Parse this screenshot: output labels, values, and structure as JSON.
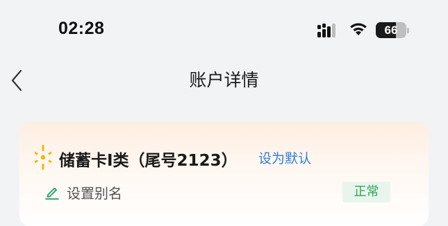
{
  "status_bar": {
    "time": "02:28",
    "battery_text": "66",
    "battery_level_percent": 66,
    "icons": [
      "signal-icon",
      "wifi-icon",
      "battery-icon"
    ]
  },
  "nav": {
    "back_icon": "chevron-left-icon",
    "title": "账户详情"
  },
  "card": {
    "logo_icon": "bank-logo-icon",
    "name": "储蓄卡I类（尾号2123）",
    "set_default_label": "设为默认",
    "alias_icon": "pencil-icon",
    "alias_label": "设置别名",
    "status_label": "正常"
  },
  "colors": {
    "link": "#2f7ed8",
    "status_green": "#2ea35a",
    "status_bg": "#e8f5ec",
    "logo_gold": "#f2b705",
    "pencil_green": "#1f9a63"
  }
}
